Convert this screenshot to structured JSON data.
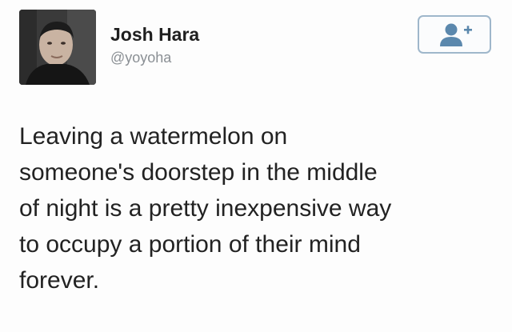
{
  "user": {
    "name": "Josh Hara",
    "handle": "@yoyoha"
  },
  "follow_button": {
    "icon": "add-user-icon",
    "color": "#5b88ad"
  },
  "tweet": {
    "lines": [
      "Leaving a watermelon on",
      "someone's doorstep in the middle",
      "of night is a pretty inexpensive way",
      "to occupy a portion of their mind",
      "forever."
    ]
  }
}
